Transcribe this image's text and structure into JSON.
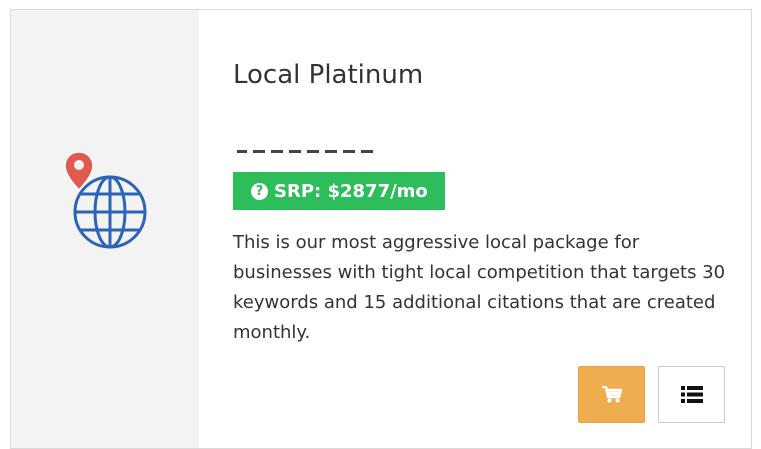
{
  "card": {
    "title": "Local Platinum",
    "srp_label": "SRP: $2877/mo",
    "description": "This is our most aggressive local package for businesses with tight local competition that targets 30 keywords and 15 additional citations that are created monthly.",
    "icon": "globe-location-pin-icon",
    "help_icon_glyph": "?"
  },
  "actions": {
    "cart_icon": "shopping-cart-icon",
    "details_icon": "list-icon"
  },
  "colors": {
    "badge": "#2dbd5a",
    "cart_button": "#f0ad4e",
    "globe": "#2b63b6",
    "pin": "#e05a4f",
    "icon_panel": "#f3f3f3",
    "text": "#333333"
  }
}
